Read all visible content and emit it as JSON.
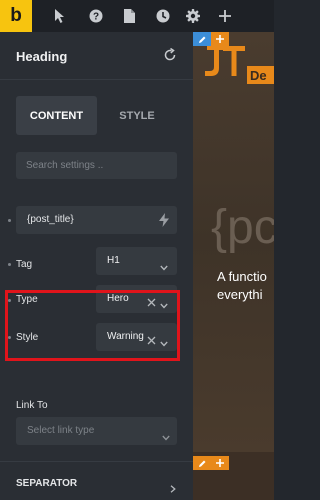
{
  "toolbar": {
    "logo_letter": "b",
    "icons": [
      "cursor-icon",
      "help-icon",
      "page-icon",
      "history-icon",
      "settings-icon",
      "add-icon"
    ]
  },
  "panel": {
    "title": "Heading",
    "tabs": {
      "content": "CONTENT",
      "style": "STYLE"
    },
    "search_placeholder": "Search settings ..",
    "text_field_value": "{post_title}",
    "tag": {
      "label": "Tag",
      "value": "H1"
    },
    "type": {
      "label": "Type",
      "value": "Hero"
    },
    "style": {
      "label": "Style",
      "value": "Warning"
    },
    "link_to": {
      "label": "Link To",
      "placeholder": "Select link type"
    },
    "separator": {
      "label": "SEPARATOR"
    }
  },
  "canvas": {
    "brand": "JT",
    "brand_suffix": "De",
    "heading_fragment": "{pc",
    "line1": "A functio",
    "line2": "everythi"
  },
  "colors": {
    "accent_yellow": "#f7c40f",
    "highlight_red": "#e0141b",
    "badge_blue": "#3c8ed8",
    "badge_orange": "#e8891a",
    "panel_bg": "#2a2e34"
  }
}
